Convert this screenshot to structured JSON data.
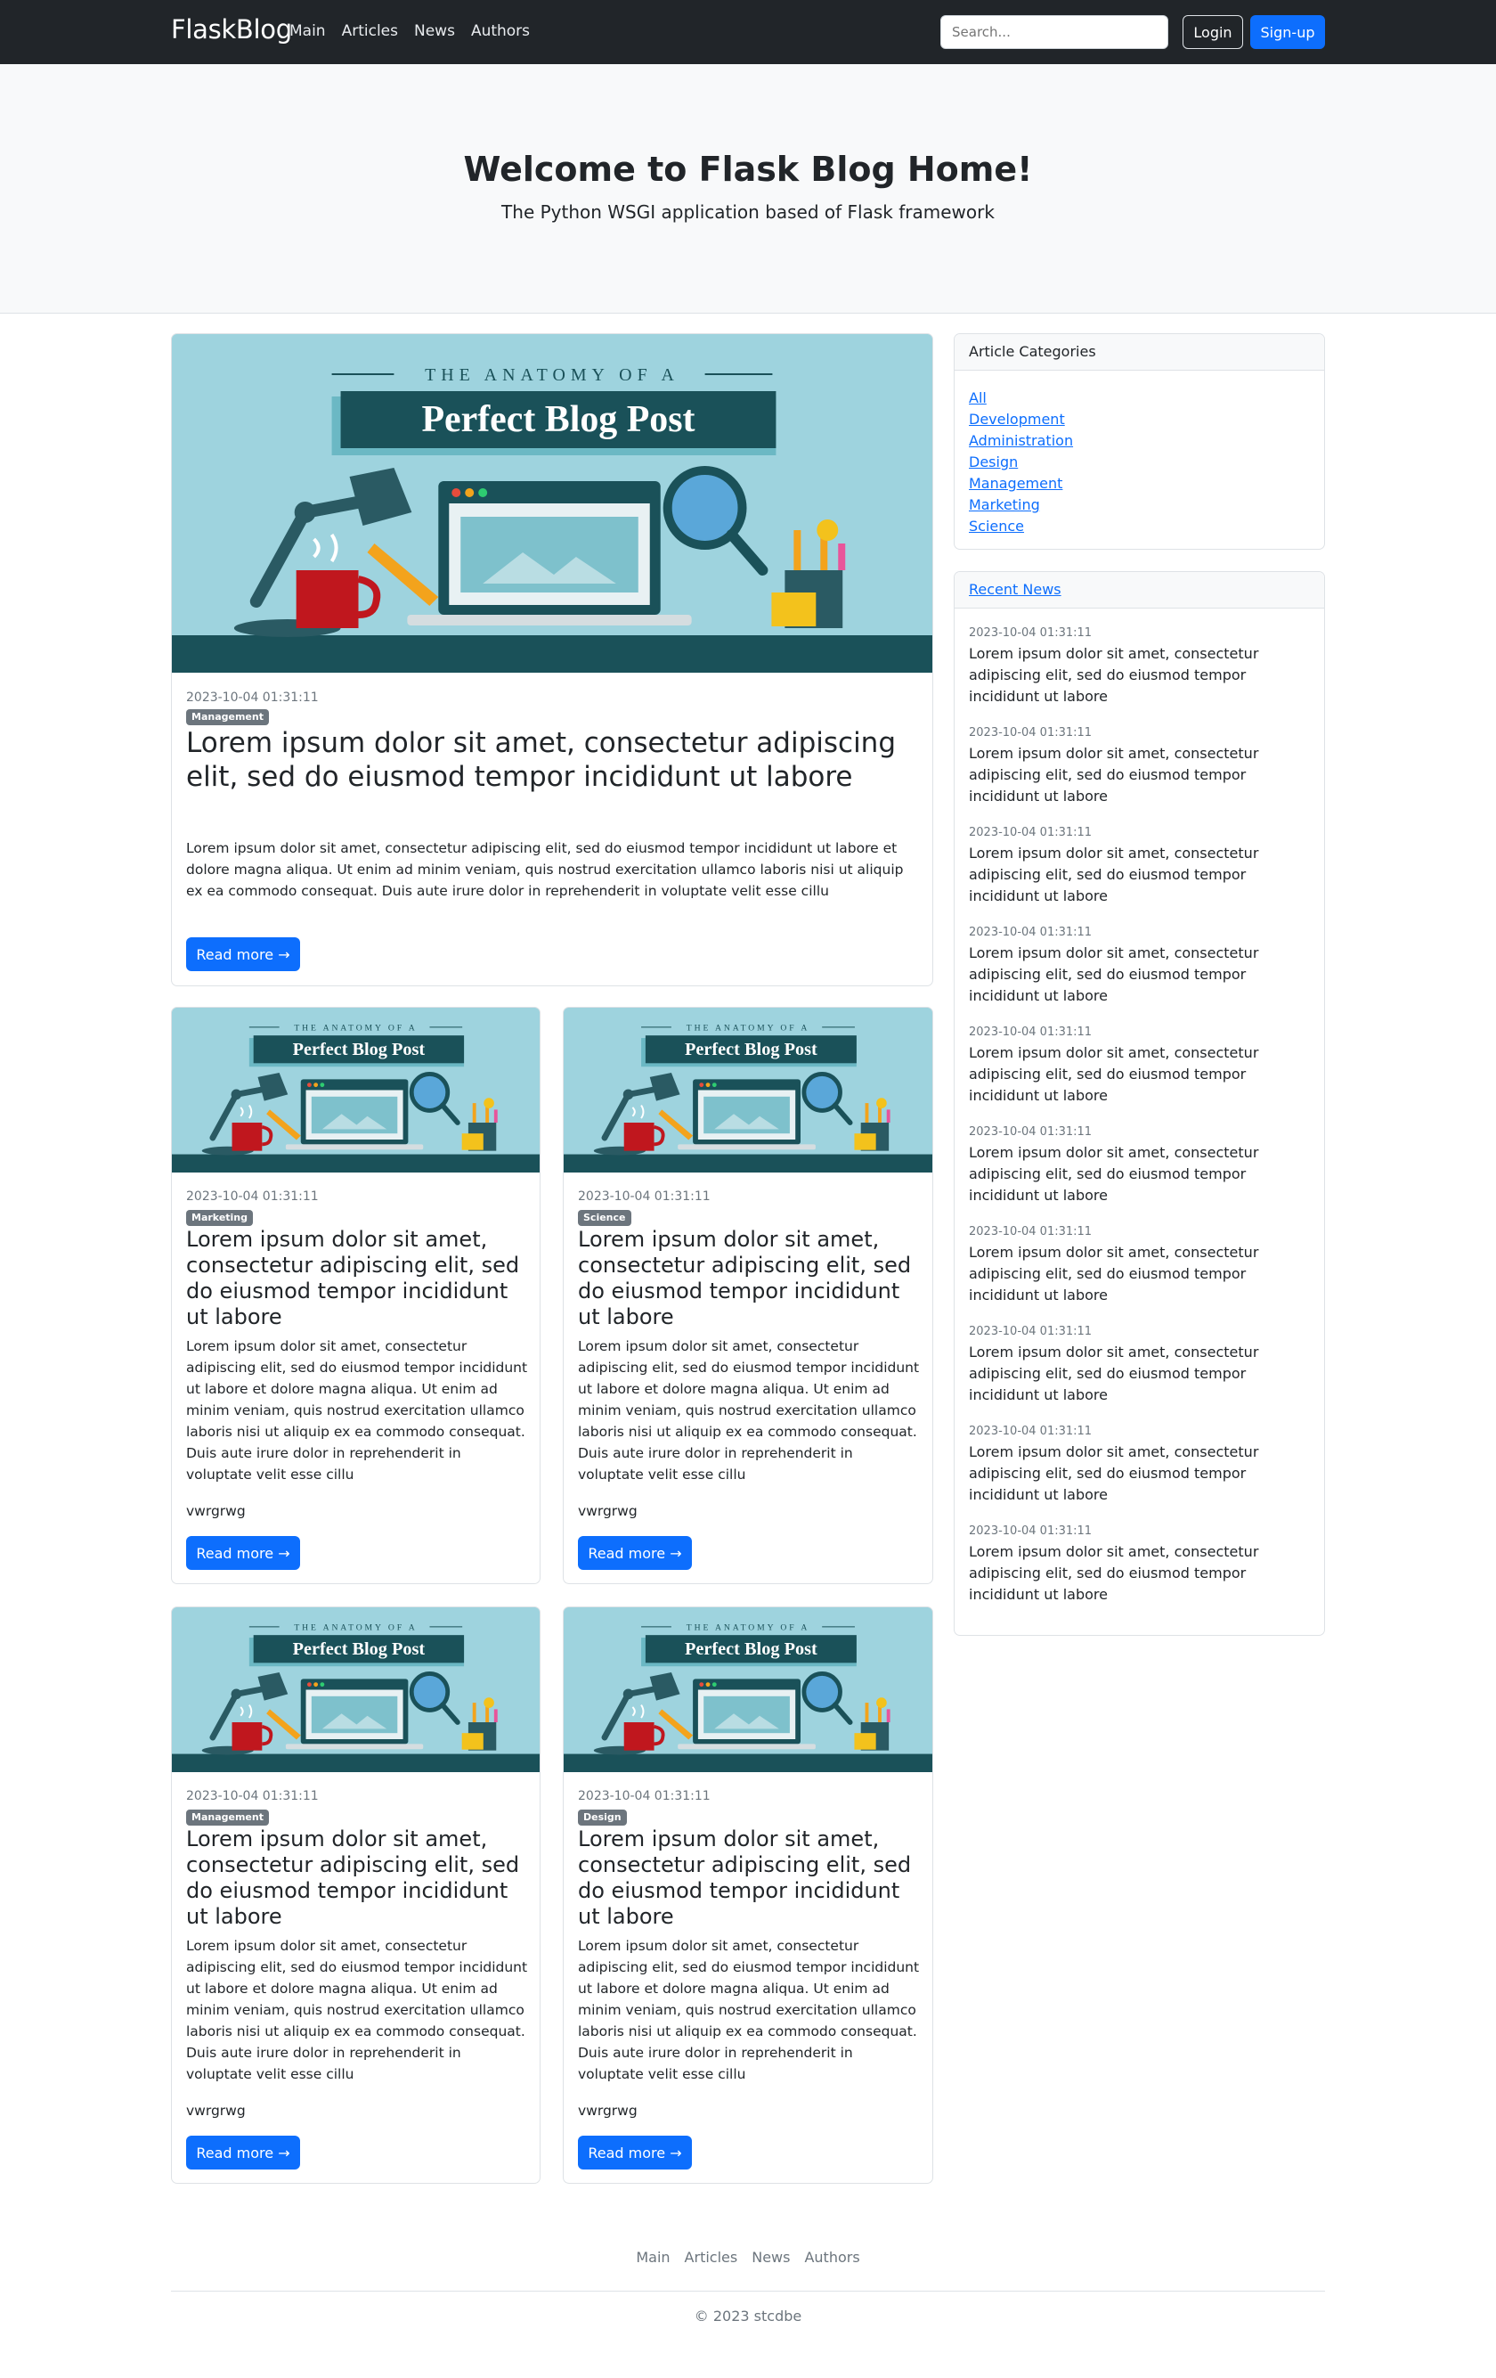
{
  "navbar": {
    "brand": "FlaskBlog",
    "links": [
      "Main",
      "Articles",
      "News",
      "Authors"
    ],
    "search_placeholder": "Search...",
    "login_label": "Login",
    "signup_label": "Sign-up"
  },
  "hero": {
    "title": "Welcome to Flask Blog Home!",
    "subtitle": "The Python WSGI application based of Flask framework"
  },
  "image_text": {
    "top": "THE ANATOMY OF A",
    "main": "Perfect Blog Post"
  },
  "featured": {
    "timestamp": "2023-10-04 01:31:11",
    "category": "Management",
    "title": "Lorem ipsum dolor sit amet, consectetur adipiscing elit, sed do eiusmod tempor incididunt ut labore",
    "text": "Lorem ipsum dolor sit amet, consectetur adipiscing elit, sed do eiusmod tempor incididunt ut labore et dolore magna aliqua. Ut enim ad minim veniam, quis nostrud exercitation ullamco laboris nisi ut aliquip ex ea commodo consequat. Duis aute irure dolor in reprehenderit in voluptate velit esse cillu",
    "read_more": "Read more →"
  },
  "posts": [
    {
      "timestamp": "2023-10-04 01:31:11",
      "category": "Marketing",
      "title": "Lorem ipsum dolor sit amet, consectetur adipiscing elit, sed do eiusmod tempor incididunt ut labore",
      "text": "Lorem ipsum dolor sit amet, consectetur adipiscing elit, sed do eiusmod tempor incididunt ut labore et dolore magna aliqua. Ut enim ad minim veniam, quis nostrud exercitation ullamco laboris nisi ut aliquip ex ea commodo consequat. Duis aute irure dolor in reprehenderit in voluptate velit esse cillu",
      "extra": "vwrgrwg",
      "read_more": "Read more →"
    },
    {
      "timestamp": "2023-10-04 01:31:11",
      "category": "Science",
      "title": "Lorem ipsum dolor sit amet, consectetur adipiscing elit, sed do eiusmod tempor incididunt ut labore",
      "text": "Lorem ipsum dolor sit amet, consectetur adipiscing elit, sed do eiusmod tempor incididunt ut labore et dolore magna aliqua. Ut enim ad minim veniam, quis nostrud exercitation ullamco laboris nisi ut aliquip ex ea commodo consequat. Duis aute irure dolor in reprehenderit in voluptate velit esse cillu",
      "extra": "vwrgrwg",
      "read_more": "Read more →"
    },
    {
      "timestamp": "2023-10-04 01:31:11",
      "category": "Management",
      "title": "Lorem ipsum dolor sit amet, consectetur adipiscing elit, sed do eiusmod tempor incididunt ut labore",
      "text": "Lorem ipsum dolor sit amet, consectetur adipiscing elit, sed do eiusmod tempor incididunt ut labore et dolore magna aliqua. Ut enim ad minim veniam, quis nostrud exercitation ullamco laboris nisi ut aliquip ex ea commodo consequat. Duis aute irure dolor in reprehenderit in voluptate velit esse cillu",
      "extra": "vwrgrwg",
      "read_more": "Read more →"
    },
    {
      "timestamp": "2023-10-04 01:31:11",
      "category": "Design",
      "title": "Lorem ipsum dolor sit amet, consectetur adipiscing elit, sed do eiusmod tempor incididunt ut labore",
      "text": "Lorem ipsum dolor sit amet, consectetur adipiscing elit, sed do eiusmod tempor incididunt ut labore et dolore magna aliqua. Ut enim ad minim veniam, quis nostrud exercitation ullamco laboris nisi ut aliquip ex ea commodo consequat. Duis aute irure dolor in reprehenderit in voluptate velit esse cillu",
      "extra": "vwrgrwg",
      "read_more": "Read more →"
    }
  ],
  "sidebar": {
    "categories_title": "Article Categories",
    "categories": [
      "All",
      "Development",
      "Administration",
      "Design",
      "Management",
      "Marketing",
      "Science"
    ],
    "news_title": "Recent News",
    "news": [
      {
        "timestamp": "2023-10-04 01:31:11",
        "text": "Lorem ipsum dolor sit amet, consectetur adipiscing elit, sed do eiusmod tempor incididunt ut labore"
      },
      {
        "timestamp": "2023-10-04 01:31:11",
        "text": "Lorem ipsum dolor sit amet, consectetur adipiscing elit, sed do eiusmod tempor incididunt ut labore"
      },
      {
        "timestamp": "2023-10-04 01:31:11",
        "text": "Lorem ipsum dolor sit amet, consectetur adipiscing elit, sed do eiusmod tempor incididunt ut labore"
      },
      {
        "timestamp": "2023-10-04 01:31:11",
        "text": "Lorem ipsum dolor sit amet, consectetur adipiscing elit, sed do eiusmod tempor incididunt ut labore"
      },
      {
        "timestamp": "2023-10-04 01:31:11",
        "text": "Lorem ipsum dolor sit amet, consectetur adipiscing elit, sed do eiusmod tempor incididunt ut labore"
      },
      {
        "timestamp": "2023-10-04 01:31:11",
        "text": "Lorem ipsum dolor sit amet, consectetur adipiscing elit, sed do eiusmod tempor incididunt ut labore"
      },
      {
        "timestamp": "2023-10-04 01:31:11",
        "text": "Lorem ipsum dolor sit amet, consectetur adipiscing elit, sed do eiusmod tempor incididunt ut labore"
      },
      {
        "timestamp": "2023-10-04 01:31:11",
        "text": "Lorem ipsum dolor sit amet, consectetur adipiscing elit, sed do eiusmod tempor incididunt ut labore"
      },
      {
        "timestamp": "2023-10-04 01:31:11",
        "text": "Lorem ipsum dolor sit amet, consectetur adipiscing elit, sed do eiusmod tempor incididunt ut labore"
      },
      {
        "timestamp": "2023-10-04 01:31:11",
        "text": "Lorem ipsum dolor sit amet, consectetur adipiscing elit, sed do eiusmod tempor incididunt ut labore"
      }
    ]
  },
  "footer": {
    "links": [
      "Main",
      "Articles",
      "News",
      "Authors"
    ],
    "copyright": "© 2023 stcdbe"
  },
  "colors": {
    "navbar": "#212529",
    "accent": "#0d6efd",
    "badge": "#6c757d",
    "image_bg": "#9ed3de",
    "image_banner": "#1a5159"
  }
}
